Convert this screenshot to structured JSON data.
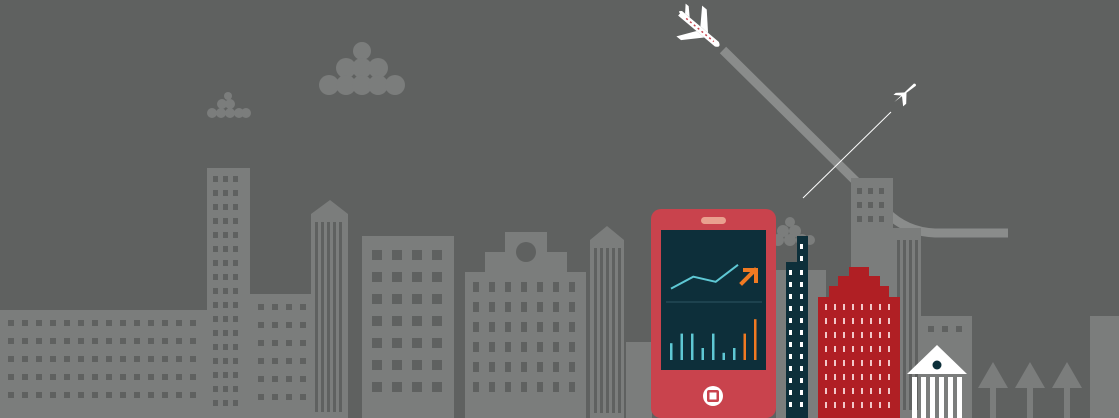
{
  "scene": {
    "background_color": "#5f6160",
    "building_color": "#7b7d7c",
    "window_color": "#5f6160",
    "phone_color": "#c9434d",
    "phone_screen_color": "#0d2f3a",
    "chart_line_color": "#5ec8d4",
    "chart_accent_color": "#f07a22",
    "red_building_color": "#b01f24",
    "teal_tower_color": "#0d2f3a",
    "bank_color": "#ffffff",
    "plane_color": "#ffffff",
    "trail_color": "#8a8c8b"
  },
  "icons": [
    "airplane-icon",
    "smartphone-icon",
    "trend-up-arrow-icon",
    "bar-chart-icon",
    "home-button-icon",
    "bank-icon",
    "tree-icon",
    "cloud-icon"
  ],
  "phone_chart": {
    "trend_line": [
      0.1,
      0.45,
      0.3,
      0.8
    ],
    "bars_teal": [
      0.35,
      0.55,
      0.55,
      0.25,
      0.55,
      0.15,
      0.25
    ],
    "bars_orange": [
      0.55,
      0.85
    ]
  }
}
